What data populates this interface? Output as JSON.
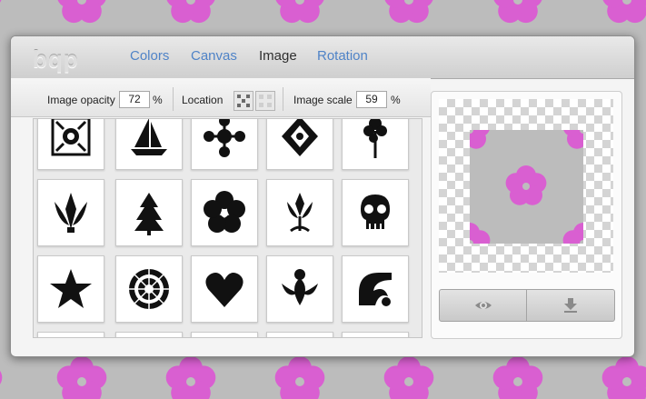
{
  "app": {
    "logo_text": "bqp"
  },
  "tabs": [
    {
      "label": "Colors",
      "active": false
    },
    {
      "label": "Canvas",
      "active": false
    },
    {
      "label": "Image",
      "active": true
    },
    {
      "label": "Rotation",
      "active": false
    }
  ],
  "controls": {
    "opacity_label": "Image opacity",
    "opacity_value": "72",
    "opacity_unit": "%",
    "location_label": "Location",
    "scale_label": "Image scale",
    "scale_value": "59",
    "scale_unit": "%"
  },
  "image_grid": [
    "ornament-tile-icon",
    "sailboat-icon",
    "snowflake-ornament-icon",
    "damask-ornament-icon",
    "tree-silhouette-icon",
    "fleur-plant-icon",
    "pine-tree-icon",
    "flower-icon",
    "lily-ornament-icon",
    "skull-icon",
    "star-icon",
    "mandala-icon",
    "heart-icon",
    "floral-ornament-icon",
    "swirl-ornament-icon"
  ],
  "preview": {
    "eye_button_icon": "eye-icon",
    "download_button_icon": "download-icon"
  },
  "colors": {
    "pattern_pink": "#d95fd1",
    "tab_link": "#4f83c7",
    "tab_active": "#2f2f2f"
  }
}
